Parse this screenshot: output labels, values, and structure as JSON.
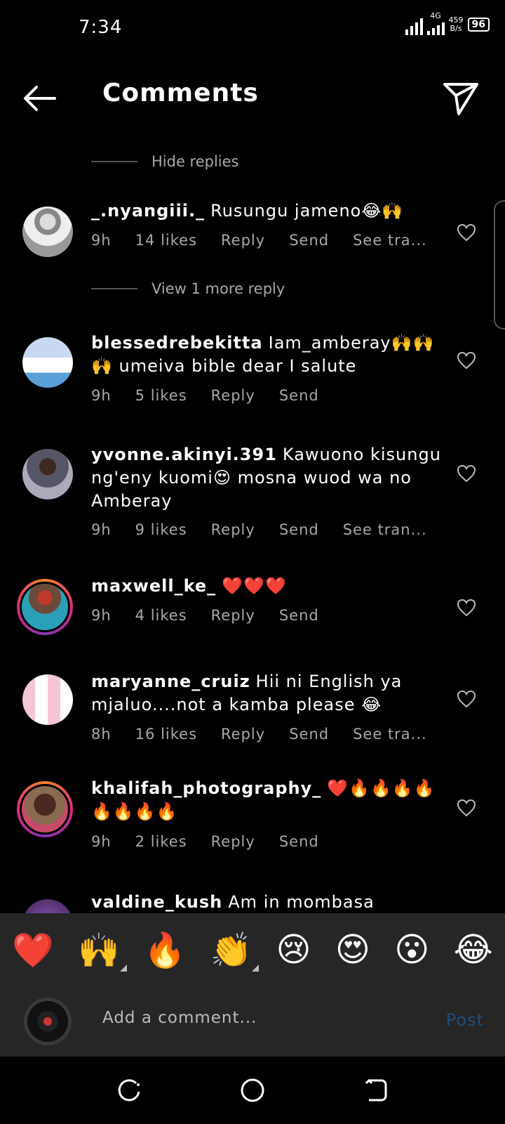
{
  "status": {
    "time": "7:34",
    "network": "4G",
    "speed_value": "459",
    "speed_unit": "B/s",
    "battery": "96"
  },
  "header": {
    "title": "Comments"
  },
  "hide_replies": "Hide replies",
  "view_more": "View 1 more reply",
  "comments": [
    {
      "user": "_.nyangiii._",
      "text": "Rusungu jameno😂🙌",
      "time": "9h",
      "likes": "14 likes",
      "reply": "Reply",
      "send": "Send",
      "translate": "See tra..."
    },
    {
      "user": "blessedrebekitta",
      "text": "Iam_amberay🙌🙌🙌 umeiva bible dear I salute",
      "time": "9h",
      "likes": "5 likes",
      "reply": "Reply",
      "send": "Send"
    },
    {
      "user": "yvonne.akinyi.391",
      "text": "Kawuono kisungu ng'eny kuomi😍 mosna wuod wa no Amberay",
      "time": "9h",
      "likes": "9 likes",
      "reply": "Reply",
      "send": "Send",
      "translate": "See tran..."
    },
    {
      "user": "maxwell_ke_",
      "text": "❤️❤️❤️",
      "time": "9h",
      "likes": "4 likes",
      "reply": "Reply",
      "send": "Send"
    },
    {
      "user": "maryanne_cruiz",
      "text": "Hii ni English ya mjaluo....not a kamba please 😂",
      "time": "8h",
      "likes": "16 likes",
      "reply": "Reply",
      "send": "Send",
      "translate": "See tra..."
    },
    {
      "user": "khalifah_photography_",
      "text": "❤️🔥🔥🔥🔥 🔥🔥🔥🔥",
      "time": "9h",
      "likes": "2 likes",
      "reply": "Reply",
      "send": "Send"
    },
    {
      "user": "valdine_kush",
      "text": "Am in mombasa anyone"
    }
  ],
  "reactions": [
    "❤️",
    "🙌",
    "🔥",
    "👏",
    "😢",
    "😍",
    "😮",
    "😂"
  ],
  "compose": {
    "placeholder": "Add a comment...",
    "post": "Post"
  },
  "icons": {
    "back": "arrow-left-icon",
    "direct": "paper-plane-icon",
    "like": "heart-outline-icon"
  }
}
